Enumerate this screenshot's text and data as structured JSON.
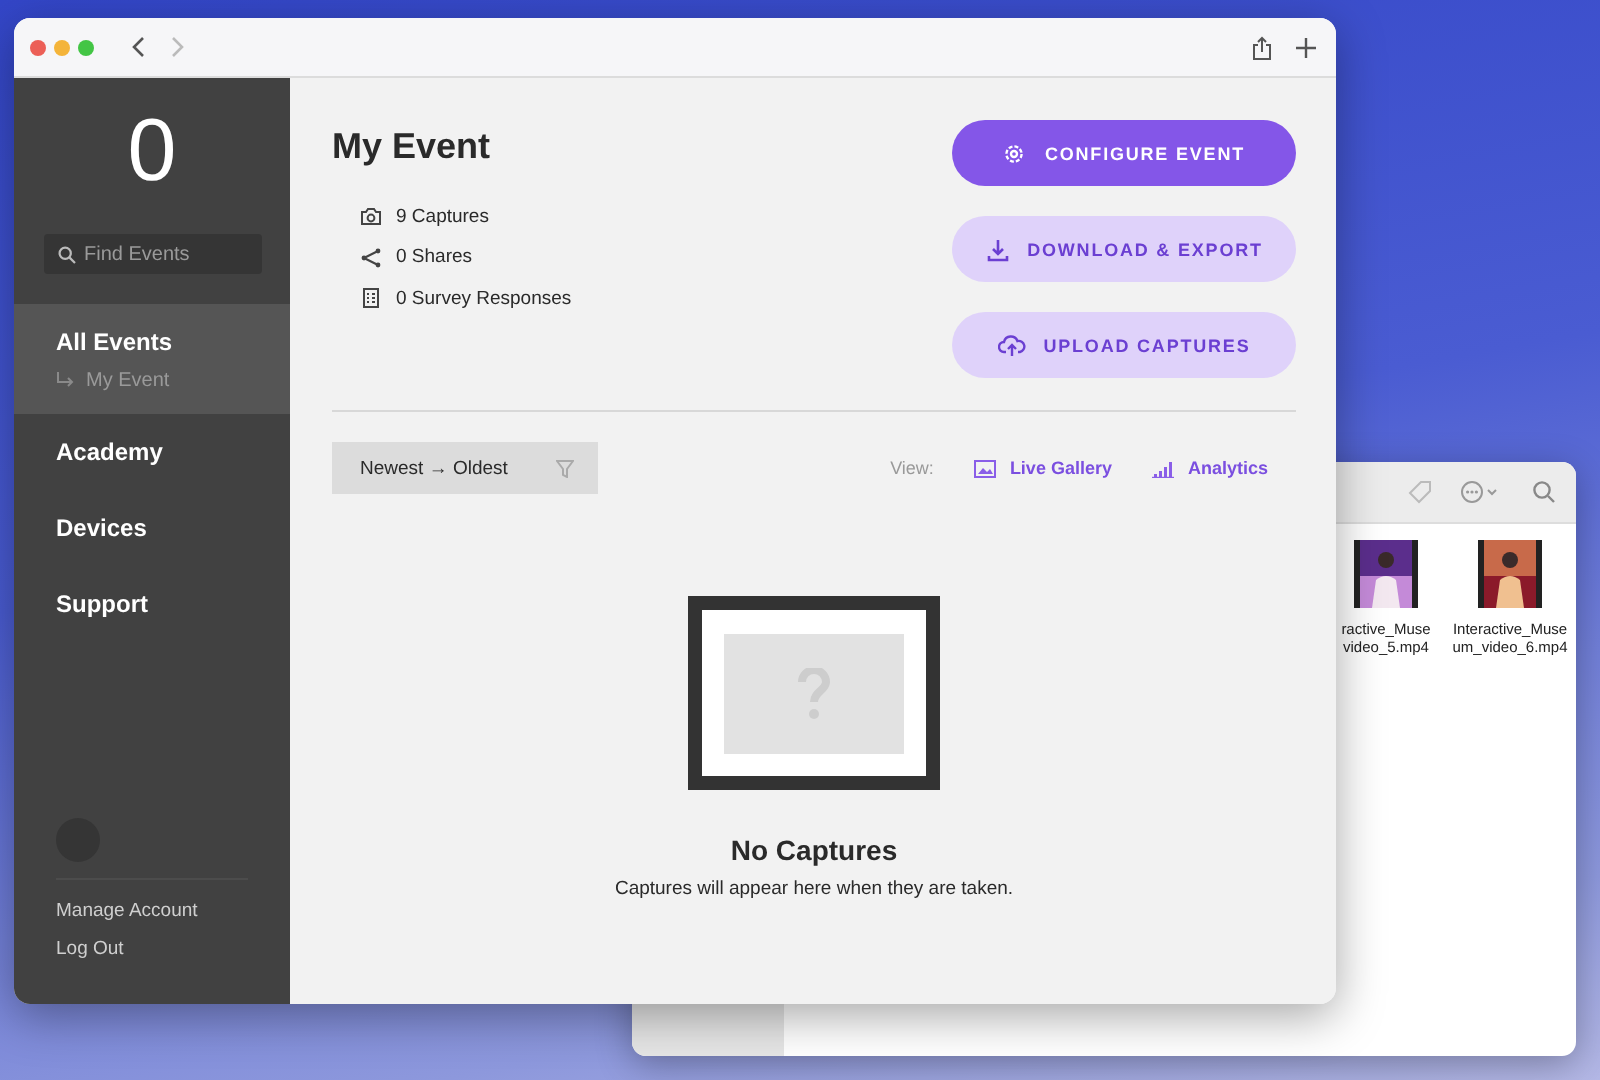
{
  "window": {
    "can_go_back": true,
    "can_go_forward": false
  },
  "sidebar": {
    "logo": "0",
    "search": {
      "placeholder": "Find Events"
    },
    "items": [
      {
        "label": "All Events",
        "selected": true,
        "children": [
          {
            "label": "My Event"
          }
        ]
      },
      {
        "label": "Academy",
        "selected": false
      },
      {
        "label": "Devices",
        "selected": false
      },
      {
        "label": "Support",
        "selected": false
      }
    ],
    "footer_links": [
      "Manage Account",
      "Log Out"
    ]
  },
  "event": {
    "title": "My Event",
    "stats": [
      {
        "kind": "camera",
        "text": "9 Captures"
      },
      {
        "kind": "share",
        "text": "0 Shares"
      },
      {
        "kind": "survey",
        "text": "0 Survey Responses"
      }
    ]
  },
  "actions": [
    {
      "kind": "gear",
      "label": "CONFIGURE EVENT",
      "primary": true
    },
    {
      "kind": "download",
      "label": "DOWNLOAD & EXPORT",
      "primary": false
    },
    {
      "kind": "upload",
      "label": "UPLOAD CAPTURES",
      "primary": false
    }
  ],
  "sort": {
    "label": "Newest → Oldest"
  },
  "view": {
    "label": "View:",
    "options": [
      {
        "kind": "gallery",
        "label": "Live Gallery"
      },
      {
        "kind": "chart",
        "label": "Analytics"
      }
    ]
  },
  "empty_state": {
    "title": "No Captures",
    "message": "Captures will appear here when they are taken."
  },
  "background_window": {
    "files": [
      {
        "kind": "picture",
        "name_lines": [
          "ractive_Muse",
          "video_5.mp4"
        ]
      },
      {
        "kind": "picture",
        "name_lines": [
          "Interactive_Muse",
          "um_video_6.mp4"
        ]
      }
    ]
  }
}
